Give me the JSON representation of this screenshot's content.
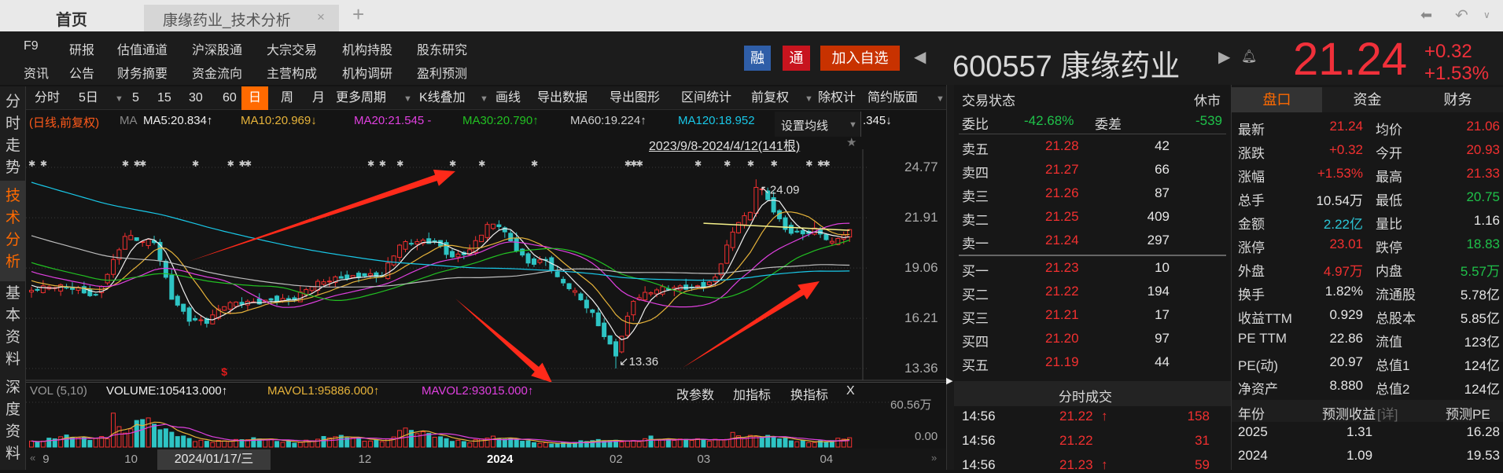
{
  "tabs": {
    "home": "首页",
    "active": "康缘药业_技术分析",
    "close": "×",
    "add": "+"
  },
  "nav_icons": [
    "back-icon",
    "undo-icon",
    "dropdown-icon"
  ],
  "menu": {
    "row1": [
      "F9",
      "研报",
      "估值通道",
      "沪深股通",
      "大宗交易",
      "机构持股",
      "股东研究"
    ],
    "row2": [
      "资讯",
      "公告",
      "财务摘要",
      "资金流向",
      "主营构成",
      "机构调研",
      "盈利预测"
    ]
  },
  "badges": {
    "rong": "融",
    "tong": "通",
    "add_watch": "加入自选"
  },
  "stock": {
    "code_name": "600557 康缘药业",
    "price": "21.24",
    "change": "+0.32",
    "change_pct": "+1.53%"
  },
  "sidebar": {
    "items": [
      {
        "label": "分时走势"
      },
      {
        "label": "技术分析",
        "active": true
      },
      {
        "label": "基本资料"
      },
      {
        "label": "深度资料"
      }
    ]
  },
  "toolbar": {
    "items": [
      "分时",
      "5日",
      "5",
      "15",
      "30",
      "60",
      "日",
      "周",
      "月",
      "更多周期",
      "K线叠加",
      "画线",
      "导出数据",
      "导出图形",
      "区间统计",
      "前复权",
      "除权计",
      "简约版面"
    ],
    "active": "日"
  },
  "ma": {
    "mode": "(日线,前复权)",
    "prefix": "MA",
    "ma5": "MA5:20.834↑",
    "ma10": "MA10:20.969↓",
    "ma20": "MA20:21.545 -",
    "ma30": "MA30:20.790↑",
    "ma60": "MA60:19.224↑",
    "ma120": "MA120:18.952",
    "tail": ".345↓",
    "set_ma": "设置均线"
  },
  "range_label": "2023/9/8-2024/4/12(141根)",
  "colors": {
    "up": "#f23030",
    "down": "#2ec4c4",
    "ma5": "#f0f0f0",
    "ma10": "#e6b33a",
    "ma20": "#e040e0",
    "ma30": "#22c022",
    "ma60": "#bdbdbd",
    "ma120": "#19c8e8",
    "accent": "#ff6a00"
  },
  "chart_data": {
    "type": "candlestick",
    "count": 141,
    "price_axis": [
      "24.77",
      "21.91",
      "19.06",
      "16.21",
      "13.36"
    ],
    "ylim": [
      13.36,
      24.77
    ],
    "close_path": [
      [
        0,
        17.8
      ],
      [
        8,
        17.9
      ],
      [
        11,
        17.6
      ],
      [
        14,
        19.5
      ],
      [
        16,
        20.8
      ],
      [
        19,
        20.4
      ],
      [
        21,
        20.5
      ],
      [
        24,
        17.5
      ],
      [
        27,
        16.3
      ],
      [
        30,
        16.0
      ],
      [
        33,
        16.8
      ],
      [
        37,
        17.1
      ],
      [
        41,
        17.4
      ],
      [
        45,
        17.3
      ],
      [
        48,
        17.9
      ],
      [
        53,
        18.6
      ],
      [
        57,
        18.8
      ],
      [
        60,
        18.6
      ],
      [
        63,
        20.2
      ],
      [
        66,
        20.5
      ],
      [
        69,
        20.7
      ],
      [
        72,
        19.8
      ],
      [
        75,
        20.0
      ],
      [
        78,
        21.3
      ],
      [
        80,
        21.4
      ],
      [
        82,
        20.6
      ],
      [
        85,
        19.5
      ],
      [
        88,
        19.6
      ],
      [
        90,
        18.4
      ],
      [
        93,
        17.5
      ],
      [
        96,
        16.4
      ],
      [
        99,
        14.8
      ],
      [
        100,
        14.3
      ],
      [
        101,
        15.4
      ],
      [
        103,
        17.3
      ],
      [
        106,
        17.6
      ],
      [
        109,
        17.8
      ],
      [
        112,
        18.0
      ],
      [
        115,
        18.2
      ],
      [
        117,
        18.6
      ],
      [
        119,
        20.3
      ],
      [
        121,
        21.6
      ],
      [
        123,
        22.0
      ],
      [
        124,
        23.6
      ],
      [
        125,
        23.4
      ],
      [
        127,
        22.4
      ],
      [
        129,
        21.4
      ],
      [
        132,
        21.1
      ],
      [
        134,
        21.2
      ],
      [
        136,
        20.6
      ],
      [
        137,
        20.3
      ],
      [
        139,
        20.9
      ],
      [
        140,
        21.24
      ]
    ],
    "prior_path": [
      [
        -120,
        30
      ],
      [
        -60,
        24
      ],
      [
        -1,
        18
      ]
    ],
    "high": {
      "index": 124,
      "value": 24.09,
      "label": "24.09"
    },
    "low": {
      "index": 100,
      "value": 13.36,
      "label": "13.36"
    },
    "markers": [
      0,
      2,
      16,
      18,
      19,
      28,
      34,
      36,
      37,
      58,
      60,
      63,
      72,
      77,
      86,
      102,
      103,
      104,
      114,
      119,
      123,
      127,
      133,
      135,
      136
    ],
    "signal": {
      "index": 33,
      "label": "$"
    },
    "volume": {
      "header": "VOL (5,10)",
      "volume": "VOLUME:105413.000↑",
      "mavol1": "MAVOL1:95886.000↑",
      "mavol2": "MAVOL2:93015.000↑",
      "axis": [
        "60.56万",
        "0.00"
      ],
      "max": 60.56,
      "path": [
        [
          0,
          9
        ],
        [
          5,
          13
        ],
        [
          10,
          9
        ],
        [
          13,
          16
        ],
        [
          14,
          58
        ],
        [
          15,
          32
        ],
        [
          17,
          28
        ],
        [
          19,
          42
        ],
        [
          21,
          24
        ],
        [
          24,
          16
        ],
        [
          28,
          11
        ],
        [
          35,
          8
        ],
        [
          40,
          10
        ],
        [
          45,
          8
        ],
        [
          50,
          11
        ],
        [
          55,
          12
        ],
        [
          58,
          10
        ],
        [
          62,
          14
        ],
        [
          63,
          27
        ],
        [
          65,
          18
        ],
        [
          70,
          12
        ],
        [
          75,
          9
        ],
        [
          78,
          14
        ],
        [
          80,
          10
        ],
        [
          85,
          7
        ],
        [
          90,
          6
        ],
        [
          95,
          7
        ],
        [
          100,
          8
        ],
        [
          103,
          10
        ],
        [
          106,
          16
        ],
        [
          108,
          9
        ],
        [
          112,
          8
        ],
        [
          118,
          12
        ],
        [
          120,
          22
        ],
        [
          122,
          14
        ],
        [
          125,
          12
        ],
        [
          130,
          9
        ],
        [
          135,
          9
        ],
        [
          140,
          10.54
        ]
      ]
    },
    "x_labels": [
      {
        "i": 3,
        "t": "9"
      },
      {
        "i": 17,
        "t": "10"
      },
      {
        "i": 57,
        "t": "12"
      },
      {
        "i": 79,
        "t": "2024",
        "bold": true
      },
      {
        "i": 100,
        "t": "02"
      },
      {
        "i": 115,
        "t": "03"
      },
      {
        "i": 136,
        "t": "04"
      }
    ]
  },
  "cursor_date": "2024/01/17/三",
  "indicator_buttons": {
    "edit": "改参数",
    "add": "加指标",
    "switch": "换指标",
    "close": "X"
  },
  "orderbook": {
    "status_label": "交易状态",
    "status": "休市",
    "wb_label": "委比",
    "wb": "-42.68%",
    "wc_label": "委差",
    "wc": "-539",
    "asks": [
      {
        "l": "卖五",
        "p": "21.28",
        "v": "42"
      },
      {
        "l": "卖四",
        "p": "21.27",
        "v": "66"
      },
      {
        "l": "卖三",
        "p": "21.26",
        "v": "87"
      },
      {
        "l": "卖二",
        "p": "21.25",
        "v": "409"
      },
      {
        "l": "卖一",
        "p": "21.24",
        "v": "297"
      }
    ],
    "bids": [
      {
        "l": "买一",
        "p": "21.23",
        "v": "10"
      },
      {
        "l": "买二",
        "p": "21.22",
        "v": "194"
      },
      {
        "l": "买三",
        "p": "21.21",
        "v": "17"
      },
      {
        "l": "买四",
        "p": "21.20",
        "v": "97"
      },
      {
        "l": "买五",
        "p": "21.19",
        "v": "44"
      }
    ]
  },
  "ticks": {
    "title": "分时成交",
    "rows": [
      {
        "t": "14:56",
        "p": "21.22",
        "a": "↑",
        "v": "158"
      },
      {
        "t": "14:56",
        "p": "21.22",
        "a": "",
        "v": "31"
      },
      {
        "t": "14:56",
        "p": "21.23",
        "a": "↑",
        "v": "59"
      }
    ]
  },
  "quote": {
    "tabs": [
      "盘口",
      "资金",
      "财务"
    ],
    "rows": [
      {
        "l1": "最新",
        "v1": "21.24",
        "c1": "red",
        "l2": "均价",
        "v2": "21.06",
        "c2": "red"
      },
      {
        "l1": "涨跌",
        "v1": "+0.32",
        "c1": "red",
        "l2": "今开",
        "v2": "20.93",
        "c2": "red"
      },
      {
        "l1": "涨幅",
        "v1": "+1.53%",
        "c1": "red",
        "l2": "最高",
        "v2": "21.33",
        "c2": "red"
      },
      {
        "l1": "总手",
        "v1": "10.54万",
        "c1": "wht",
        "l2": "最低",
        "v2": "20.75",
        "c2": "grn"
      },
      {
        "l1": "金额",
        "v1": "2.22亿",
        "c1": "cyan",
        "l2": "量比",
        "v2": "1.16",
        "c2": "wht"
      },
      {
        "l1": "涨停",
        "v1": "23.01",
        "c1": "red",
        "l2": "跌停",
        "v2": "18.83",
        "c2": "grn"
      },
      {
        "l1": "外盘",
        "v1": "4.97万",
        "c1": "red",
        "l2": "内盘",
        "v2": "5.57万",
        "c2": "grn"
      },
      {
        "l1": "换手",
        "v1": "1.82%",
        "c1": "wht",
        "l2": "流通股",
        "v2": "5.78亿",
        "c2": "wht"
      },
      {
        "l1": "收益TTM",
        "v1": "0.929",
        "c1": "wht",
        "l2": "总股本",
        "v2": "5.85亿",
        "c2": "wht"
      },
      {
        "l1": "PE TTM",
        "v1": "22.86",
        "c1": "wht",
        "l2": "流值",
        "v2": "123亿",
        "c2": "wht"
      },
      {
        "l1": "PE(动)",
        "v1": "20.97",
        "c1": "wht",
        "l2": "总值1",
        "v2": "124亿",
        "c2": "wht"
      },
      {
        "l1": "净资产",
        "v1": "8.880",
        "c1": "wht",
        "l2": "总值2",
        "v2": "124亿",
        "c2": "wht"
      }
    ],
    "forecast_header": {
      "year": "年份",
      "eps": "预测收益",
      "detail": "[详]",
      "pe": "预测PE"
    },
    "forecast": [
      {
        "y": "2025",
        "e": "1.31",
        "pe": "16.28"
      },
      {
        "y": "2024",
        "e": "1.09",
        "pe": "19.53"
      }
    ]
  }
}
